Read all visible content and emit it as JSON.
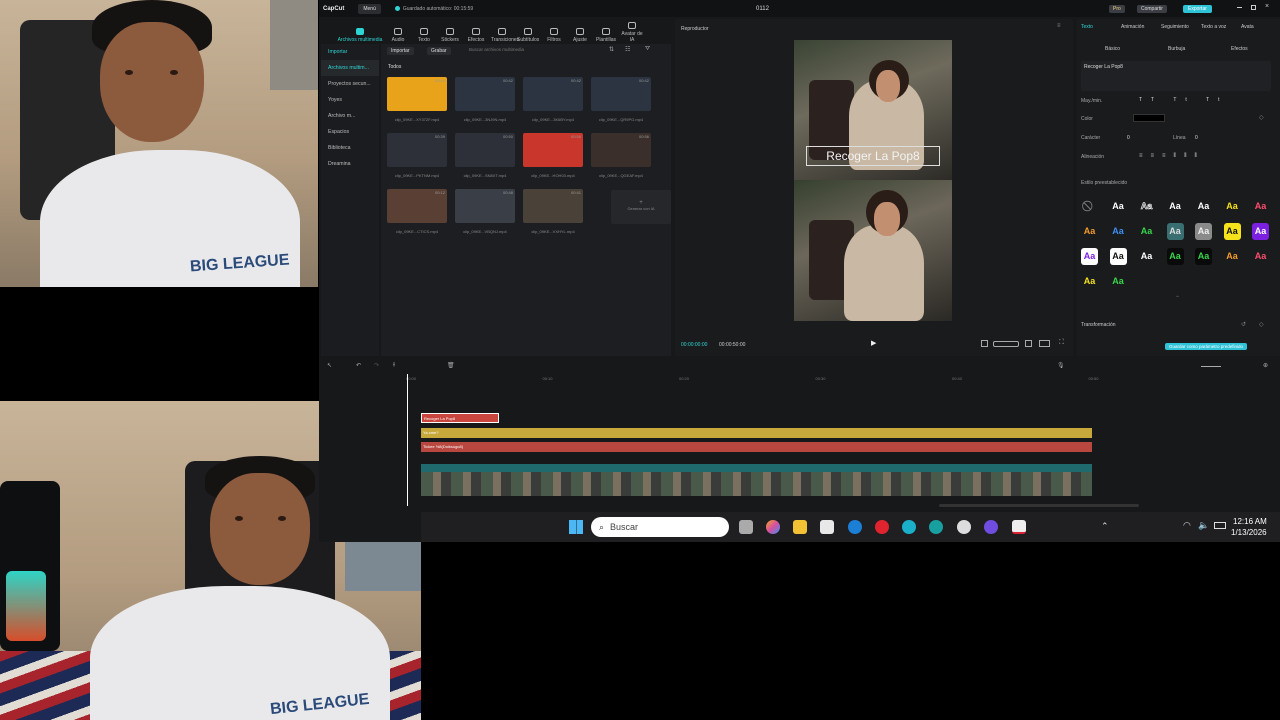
{
  "app": {
    "logo": "CapCut",
    "menu": "Menú",
    "autosave": "Guardado automático: 00:15:59",
    "project_title": "0112",
    "pro": "Pro",
    "share": "Compartir",
    "export": "Exportar"
  },
  "toolbar_tabs": [
    {
      "label": "Archivos multimedia",
      "active": true
    },
    {
      "label": "Audio"
    },
    {
      "label": "Texto"
    },
    {
      "label": "Stickers"
    },
    {
      "label": "Efectos"
    },
    {
      "label": "Transiciones"
    },
    {
      "label": "Subtítulos"
    },
    {
      "label": "Filtros"
    },
    {
      "label": "Ajuste"
    },
    {
      "label": "Plantillas"
    },
    {
      "label": "Avatar de IA"
    }
  ],
  "sidebar": {
    "importar": "Importar",
    "items": [
      "Archivos multim...",
      "Proyectos secun...",
      "Yoyes",
      "Archivo m...",
      "Espacios",
      "Biblioteca",
      "Dreamina"
    ]
  },
  "media": {
    "import_button": "Importar",
    "record_button": "Grabar",
    "search_placeholder": "Buscar archivos multimedia",
    "filter_all": "Todos",
    "clips": [
      {
        "name": "clip_09KE...XY37ZF.mp4",
        "duration": "00:10",
        "color": "#e8a31a"
      },
      {
        "name": "clip_09KE...3NJ9N.mp4",
        "duration": "00:42",
        "color": "#2b3440"
      },
      {
        "name": "clip_09KE...3K6BY.mp4",
        "duration": "00:42",
        "color": "#2b3440"
      },
      {
        "name": "clip_09KE...QR9PG.mp4",
        "duration": "00:42",
        "color": "#2b3440"
      },
      {
        "name": "clip_09KE...PKTNM.mp4",
        "duration": "00:39",
        "color": "#2d3038"
      },
      {
        "name": "clip_09KE...SN8XT.mp4",
        "duration": "00:50",
        "color": "#2d3038"
      },
      {
        "name": "clip_09KE...HOH03.mp4",
        "duration": "00:56",
        "color": "#c9362c"
      },
      {
        "name": "clip_09KE...QGEAF.mp4",
        "duration": "00:56",
        "color": "#3a2f2a"
      },
      {
        "name": "clip_09KE...CTICS.mp4",
        "duration": "00:12",
        "color": "#5a4034"
      },
      {
        "name": "clip_09KE...VBQNJ.mp4",
        "duration": "00:48",
        "color": "#3a3e46"
      },
      {
        "name": "clip_09KE...VXHYL.mp4",
        "duration": "00:41",
        "color": "#4a4238"
      }
    ],
    "ai_generate": "Generar con IA"
  },
  "player": {
    "title": "Reproductor",
    "caption": "Recoger La Pop8",
    "time_current": "00:00:00:00",
    "time_total": "00:00:50:00"
  },
  "props": {
    "tabs": [
      "Texto",
      "Animación",
      "Seguimiento",
      "Texto a voz",
      "Avata"
    ],
    "subtabs": [
      "Básico",
      "Burbuja",
      "Efectos"
    ],
    "text_value": "Recoger La Pop8",
    "label_case": "May./min.",
    "label_color": "Color",
    "label_char": "Carácter",
    "char_value": "0",
    "label_line": "Línea",
    "line_value": "0",
    "label_align": "Alineación",
    "label_presets": "Estilo preestablecido",
    "label_transform": "Transformación",
    "save_preset": "Guardar como parámetro predefinido",
    "preset_glyph": "Aa",
    "presets": [
      {
        "bg": "transparent",
        "fg": "#777",
        "glyph": "⃠"
      },
      {
        "bg": "transparent",
        "fg": "#fff"
      },
      {
        "bg": "transparent",
        "fg": "#fff",
        "outline": true
      },
      {
        "bg": "transparent",
        "fg": "#fff"
      },
      {
        "bg": "transparent",
        "fg": "#fff"
      },
      {
        "bg": "transparent",
        "fg": "#f5e21b"
      },
      {
        "bg": "transparent",
        "fg": "#ff4d6d"
      },
      {
        "bg": "transparent",
        "fg": "#f59b2b"
      },
      {
        "bg": "transparent",
        "fg": "#3d8ff5"
      },
      {
        "bg": "transparent",
        "fg": "#36d64a"
      },
      {
        "bg": "#3a6f72",
        "fg": "#ddd"
      },
      {
        "bg": "#8a8a8a",
        "fg": "#eee"
      },
      {
        "bg": "#f5e21b",
        "fg": "#111"
      },
      {
        "bg": "#7b1fe0",
        "fg": "#fff"
      },
      {
        "bg": "#ffffff",
        "fg": "#7b1fe0"
      },
      {
        "bg": "#ffffff",
        "fg": "#111"
      },
      {
        "bg": "transparent",
        "fg": "#fff"
      },
      {
        "bg": "#0a0a0a",
        "fg": "#36d64a"
      },
      {
        "bg": "#0a0a0a",
        "fg": "#36d64a"
      },
      {
        "bg": "transparent",
        "fg": "#f59b2b"
      },
      {
        "bg": "transparent",
        "fg": "#ff4d6d"
      },
      {
        "bg": "transparent",
        "fg": "#f5e21b"
      },
      {
        "bg": "transparent",
        "fg": "#36d64a"
      }
    ]
  },
  "timeline": {
    "ruler": [
      "00:00",
      "00:10",
      "00:20",
      "00:30",
      "00:40",
      "00:50"
    ],
    "text_clip": "Recoger La Pop8",
    "track_yellow": "Ya.cme?",
    "track_red": "Tickee %8(Doiksugo8)",
    "video_track": "clip_09KE1VSKKHQ3WH03HNWXRH9.mp4  00:00:50:00"
  },
  "taskbar": {
    "search": "Buscar",
    "time": "12:16 AM",
    "date": "1/13/2026"
  }
}
